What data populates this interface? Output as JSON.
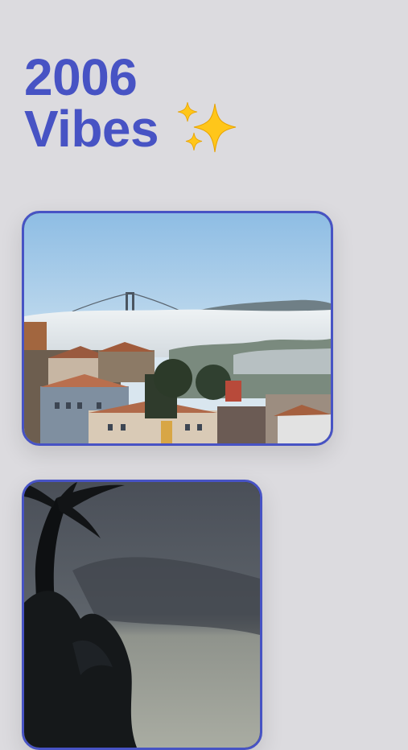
{
  "header": {
    "title_line1": "2006",
    "title_line2": "Vibes",
    "emoji": "sparkles-icon"
  },
  "photos": [
    {
      "name": "foggy-bridge-photo"
    },
    {
      "name": "palm-silhouette-photo"
    }
  ],
  "colors": {
    "accent": "#4753c4",
    "background": "#dcdbdf"
  }
}
